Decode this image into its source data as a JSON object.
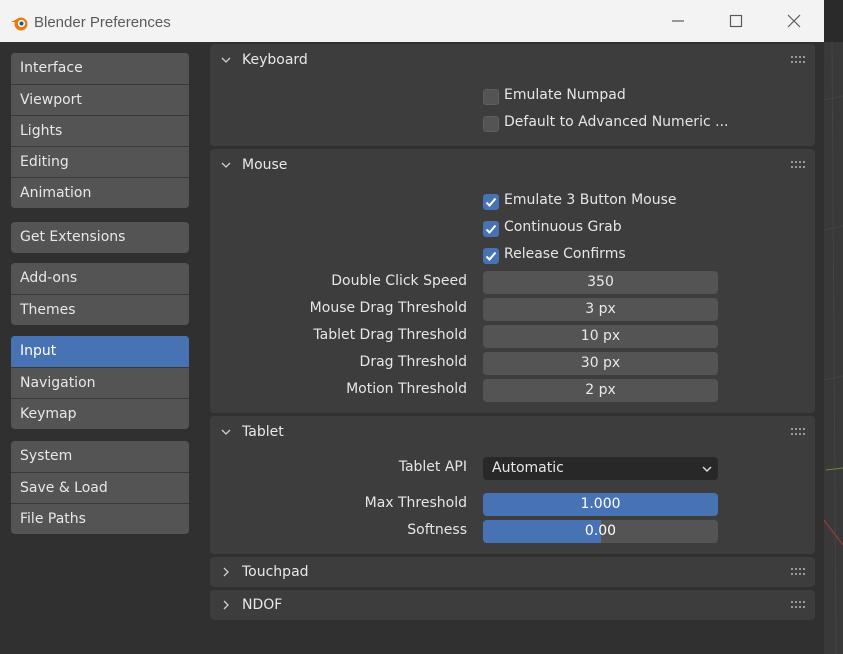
{
  "window": {
    "title": "Blender Preferences",
    "accent_color": "#4772b3"
  },
  "icons": {
    "app": "blender-logo-icon",
    "minimize": "minimize-icon",
    "maximize": "maximize-icon",
    "close": "close-icon",
    "expanded": "chevron-down-icon",
    "collapsed": "chevron-right-icon",
    "drag": "drag-grip-icon"
  },
  "sidebar": {
    "groups": [
      {
        "items": [
          {
            "label": "Interface"
          },
          {
            "label": "Viewport"
          },
          {
            "label": "Lights"
          },
          {
            "label": "Editing"
          },
          {
            "label": "Animation"
          }
        ]
      },
      {
        "items": [
          {
            "label": "Get Extensions"
          }
        ]
      },
      {
        "items": [
          {
            "label": "Add-ons"
          },
          {
            "label": "Themes"
          }
        ]
      },
      {
        "items": [
          {
            "label": "Input",
            "active": true
          },
          {
            "label": "Navigation"
          },
          {
            "label": "Keymap"
          }
        ]
      },
      {
        "items": [
          {
            "label": "System"
          },
          {
            "label": "Save & Load"
          },
          {
            "label": "File Paths"
          }
        ]
      }
    ]
  },
  "panels": {
    "keyboard": {
      "title": "Keyboard",
      "expanded": true,
      "emulate_numpad": {
        "label": "Emulate Numpad",
        "checked": false
      },
      "advanced_numeric": {
        "label": "Default to Advanced Numeric ...",
        "checked": false
      }
    },
    "mouse": {
      "title": "Mouse",
      "expanded": true,
      "emulate_3_button": {
        "label": "Emulate 3 Button Mouse",
        "checked": true
      },
      "continuous_grab": {
        "label": "Continuous Grab",
        "checked": true
      },
      "release_confirms": {
        "label": "Release Confirms",
        "checked": true
      },
      "double_click_speed": {
        "label": "Double Click Speed",
        "value": "350"
      },
      "mouse_drag_threshold": {
        "label": "Mouse Drag Threshold",
        "value": "3 px"
      },
      "tablet_drag_threshold": {
        "label": "Tablet Drag Threshold",
        "value": "10 px"
      },
      "drag_threshold": {
        "label": "Drag Threshold",
        "value": "30 px"
      },
      "motion_threshold": {
        "label": "Motion Threshold",
        "value": "2 px"
      }
    },
    "tablet": {
      "title": "Tablet",
      "expanded": true,
      "api": {
        "label": "Tablet API",
        "value": "Automatic"
      },
      "max_threshold": {
        "label": "Max Threshold",
        "value": "1.000",
        "fill_fraction": 1.0
      },
      "softness": {
        "label": "Softness",
        "value": "0.00",
        "fill_fraction": 0.5
      }
    },
    "touchpad": {
      "title": "Touchpad",
      "expanded": false
    },
    "ndof": {
      "title": "NDOF",
      "expanded": false
    }
  }
}
